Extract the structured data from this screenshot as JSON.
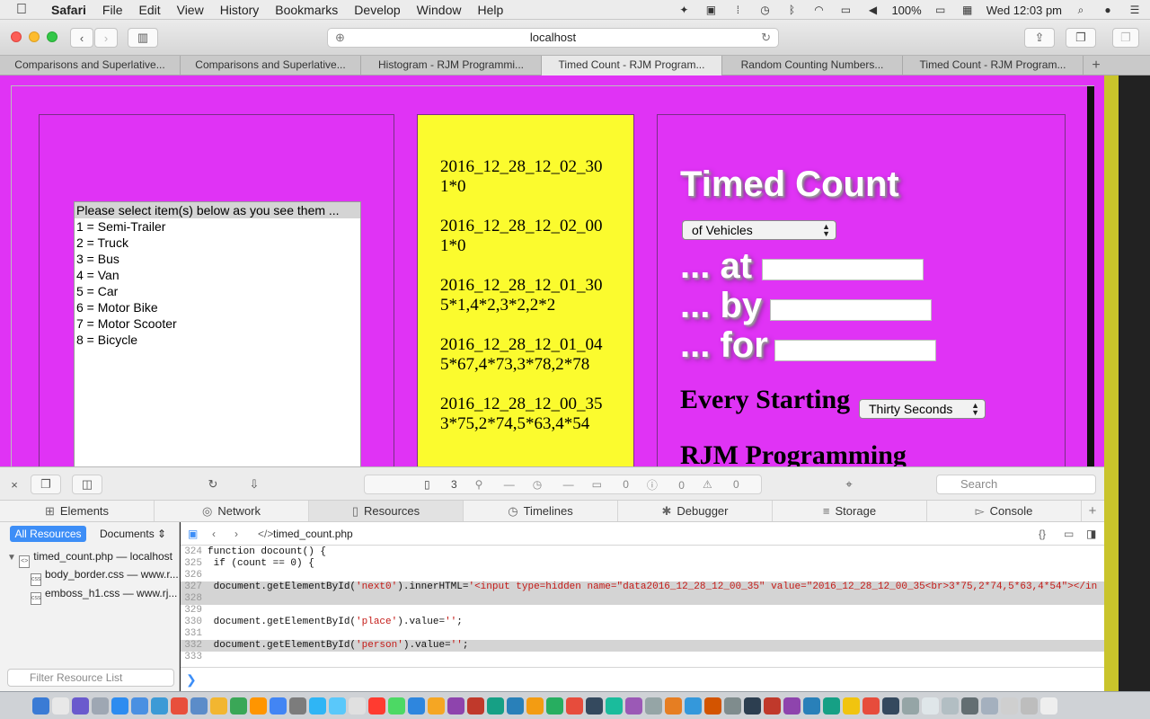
{
  "menubar": {
    "apple": "",
    "items": [
      "Safari",
      "File",
      "Edit",
      "View",
      "History",
      "Bookmarks",
      "Develop",
      "Window",
      "Help"
    ],
    "battery": "100%",
    "clock": "Wed 12:03 pm"
  },
  "toolbar": {
    "url": "localhost"
  },
  "tabs": [
    "Comparisons and Superlative...",
    "Comparisons and Superlative...",
    "Histogram - RJM Programmi...",
    "Timed Count - RJM Program...",
    "Random Counting Numbers...",
    "Timed Count - RJM Program..."
  ],
  "active_tab_index": 3,
  "page": {
    "listbox": {
      "header": "Please select item(s) below as you see them ...",
      "options": [
        "1 = Semi-Trailer",
        "2 = Truck",
        "3 = Bus",
        "4 = Van",
        "5 = Car",
        "6 = Motor Bike",
        "7 = Motor Scooter",
        "8 = Bicycle"
      ]
    },
    "entries": [
      {
        "stamp": "2016_12_28_12_02_30",
        "data": "1*0"
      },
      {
        "stamp": "2016_12_28_12_02_00",
        "data": "1*0"
      },
      {
        "stamp": "2016_12_28_12_01_30",
        "data": "5*1,4*2,3*2,2*2"
      },
      {
        "stamp": "2016_12_28_12_01_04",
        "data": "5*67,4*73,3*78,2*78"
      },
      {
        "stamp": "2016_12_28_12_00_35",
        "data": "3*75,2*74,5*63,4*54"
      }
    ],
    "form": {
      "title": "Timed Count",
      "of_select": "of Vehicles",
      "at_label": "... at",
      "by_label": "... by",
      "for_label": "... for",
      "every_label": "Every Starting",
      "interval_select": "Thirty Seconds",
      "footer": "RJM Programming"
    }
  },
  "inspector": {
    "resource_count": "3",
    "activity": {
      "network": "—",
      "time": "—",
      "messages": "0",
      "errors": "0",
      "warnings": "0"
    },
    "search_placeholder": "Search",
    "tabs": [
      "Elements",
      "Network",
      "Resources",
      "Timelines",
      "Debugger",
      "Storage",
      "Console"
    ],
    "active_tab": "Resources",
    "sidebar": {
      "all_resources": "All Resources",
      "documents": "Documents",
      "root": "timed_count.php — localhost",
      "children": [
        "body_border.css — www.r...",
        "emboss_h1.css — www.rj..."
      ],
      "filter_placeholder": "Filter Resource List"
    },
    "file_name": "timed_count.php",
    "code": [
      {
        "n": "324",
        "text": "function docount() {",
        "hl": false
      },
      {
        "n": "325",
        "text": "  if (count == 0) {",
        "hl": false
      },
      {
        "n": "326",
        "text": "",
        "hl": false
      },
      {
        "n": "327",
        "text": " document.getElementById('next0').innerHTML='<input type=hidden name=\"data2016_12_28_12_00_35\" value=\"2016_12_28_12_00_35<br>3*75,2*74,5*63,4*54\"></in",
        "hl": true
      },
      {
        "n": "328",
        "text": "",
        "hl": true
      },
      {
        "n": "329",
        "text": "",
        "hl": false
      },
      {
        "n": "330",
        "text": " document.getElementById('place').value='';",
        "hl": false
      },
      {
        "n": "331",
        "text": "",
        "hl": false
      },
      {
        "n": "332",
        "text": " document.getElementById('person').value='';",
        "hl": true
      },
      {
        "n": "333",
        "text": "",
        "hl": false
      }
    ],
    "prompt": "❯"
  },
  "colors": {
    "page_bg": "#e033f5",
    "middle_panel": "#fbfb2e",
    "accent": "#3d8ef7"
  }
}
